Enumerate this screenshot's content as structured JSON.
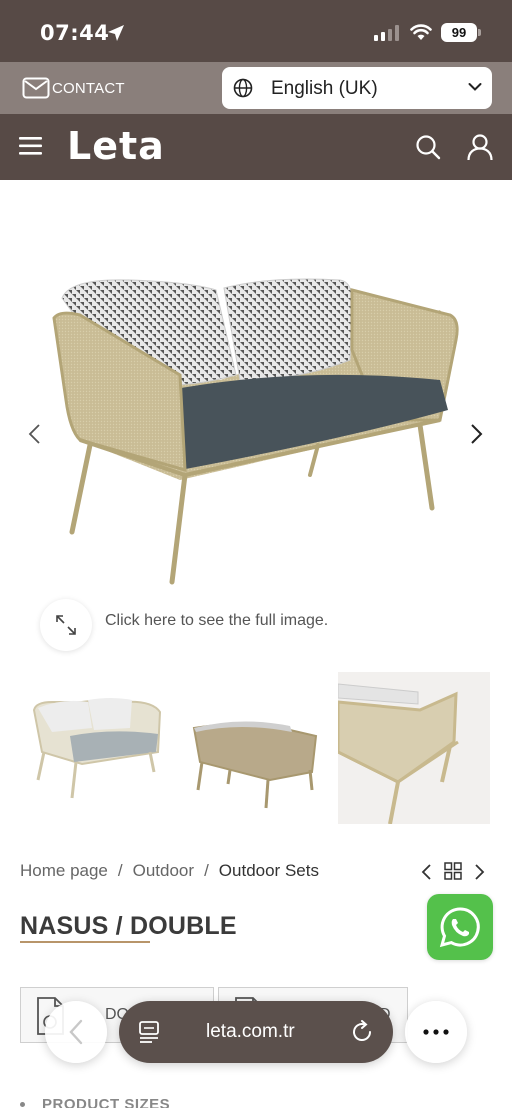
{
  "status_bar": {
    "time": "07:44",
    "battery": "99"
  },
  "topbar": {
    "contact_label": "CONTACT",
    "language": "English (UK)"
  },
  "navbar": {
    "logo": "Leta"
  },
  "hero": {
    "zoom_caption": "Click here to see the full image."
  },
  "breadcrumb": {
    "items": [
      "Home page",
      "Outdoor",
      "Outdoor Sets"
    ],
    "separator": "/"
  },
  "product": {
    "title": "NASUS / DOUBLE",
    "doc_buttons": [
      "DO",
      "D"
    ],
    "sizes_label": "PRODUCT SIZES"
  },
  "browser": {
    "url": "leta.com.tr"
  },
  "colors": {
    "brand_dark": "#574a46",
    "brand_mid": "#8a7f7b",
    "accent_underline": "#b8956a",
    "whatsapp_green": "#54c14b"
  }
}
